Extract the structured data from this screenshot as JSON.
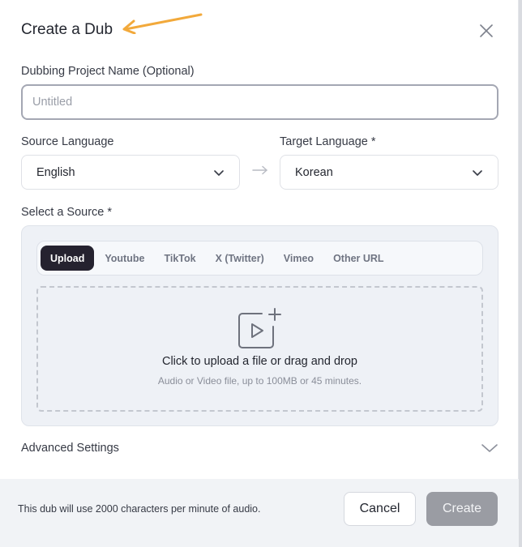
{
  "dialog": {
    "title": "Create a Dub"
  },
  "project_name": {
    "label": "Dubbing Project Name (Optional)",
    "placeholder": "Untitled",
    "value": ""
  },
  "languages": {
    "source_label": "Source Language",
    "source_value": "English",
    "target_label": "Target Language *",
    "target_value": "Korean"
  },
  "source": {
    "label": "Select a Source *",
    "tabs": [
      {
        "label": "Upload",
        "active": true
      },
      {
        "label": "Youtube",
        "active": false
      },
      {
        "label": "TikTok",
        "active": false
      },
      {
        "label": "X (Twitter)",
        "active": false
      },
      {
        "label": "Vimeo",
        "active": false
      },
      {
        "label": "Other URL",
        "active": false
      }
    ],
    "dropzone_title": "Click to upload a file or drag and drop",
    "dropzone_subtitle": "Audio or Video file, up to 100MB or 45 minutes."
  },
  "advanced": {
    "label": "Advanced Settings"
  },
  "footer": {
    "note": "This dub will use 2000 characters per minute of audio.",
    "cancel_label": "Cancel",
    "create_label": "Create"
  },
  "colors": {
    "annotation_arrow": "#f2a93b",
    "active_tab_bg": "#25222f",
    "create_button_bg": "#9a9ca3"
  },
  "icons": {
    "close": "close-icon",
    "chevron": "chevron-down-icon",
    "lang_arrow": "arrow-right-icon",
    "upload": "video-upload-icon"
  }
}
